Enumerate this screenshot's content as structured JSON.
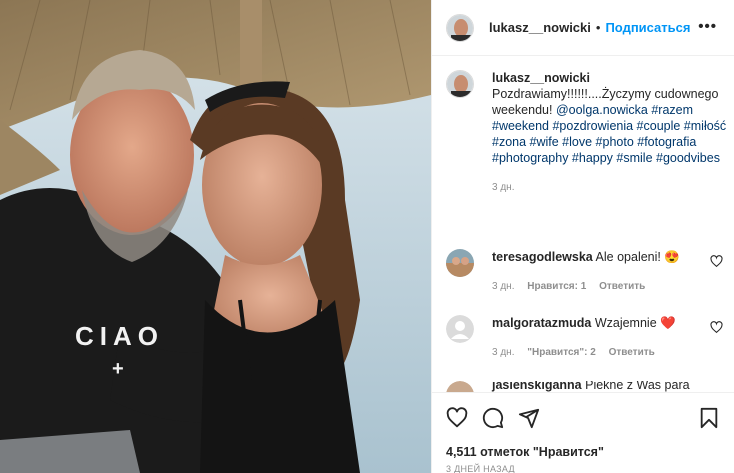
{
  "header": {
    "username": "lukasz__nowicki",
    "separator": "•",
    "follow_label": "Подписаться",
    "more_icon": "more-dots-icon",
    "more_label": "•••"
  },
  "caption": {
    "username": "lukasz__nowicki",
    "text": "Pozdrawiamy!!!!!!....Życzymy cudownego weekendu!",
    "tags": "@oolga.nowicka #razem #weekend #pozdrowienia #couple #miłość #zona #wife #love #photo #fotografia #photography #happy #smile #goodvibes",
    "time": "3 дн."
  },
  "comments": [
    {
      "username": "teresagodlewska",
      "text": "Ale opaleni!",
      "emoji": "😍",
      "time": "3 дн.",
      "likes": "Нравится: 1",
      "reply": "Ответить"
    },
    {
      "username": "malgoratazmuda",
      "text": "Wzajemnie",
      "emoji": "❤️",
      "time": "3 дн.",
      "likes": "\"Нравится\": 2",
      "reply": "Ответить"
    },
    {
      "username": "jasienskiganna",
      "text": "Piekne z Was para"
    }
  ],
  "photo": {
    "shirt_text": "CIAO",
    "shirt_symbol": "+"
  },
  "likes_text": "4,511 отметок \"Нравится\"",
  "date_text": "3 ДНЕЙ НАЗАД",
  "icons": {
    "like": "heart-icon",
    "comment": "comment-icon",
    "share": "share-icon",
    "save": "bookmark-icon"
  },
  "colors": {
    "link": "#0095f6",
    "tag": "#00376b",
    "secondary": "#8e8e8e",
    "heart_red": "#ed4956"
  }
}
